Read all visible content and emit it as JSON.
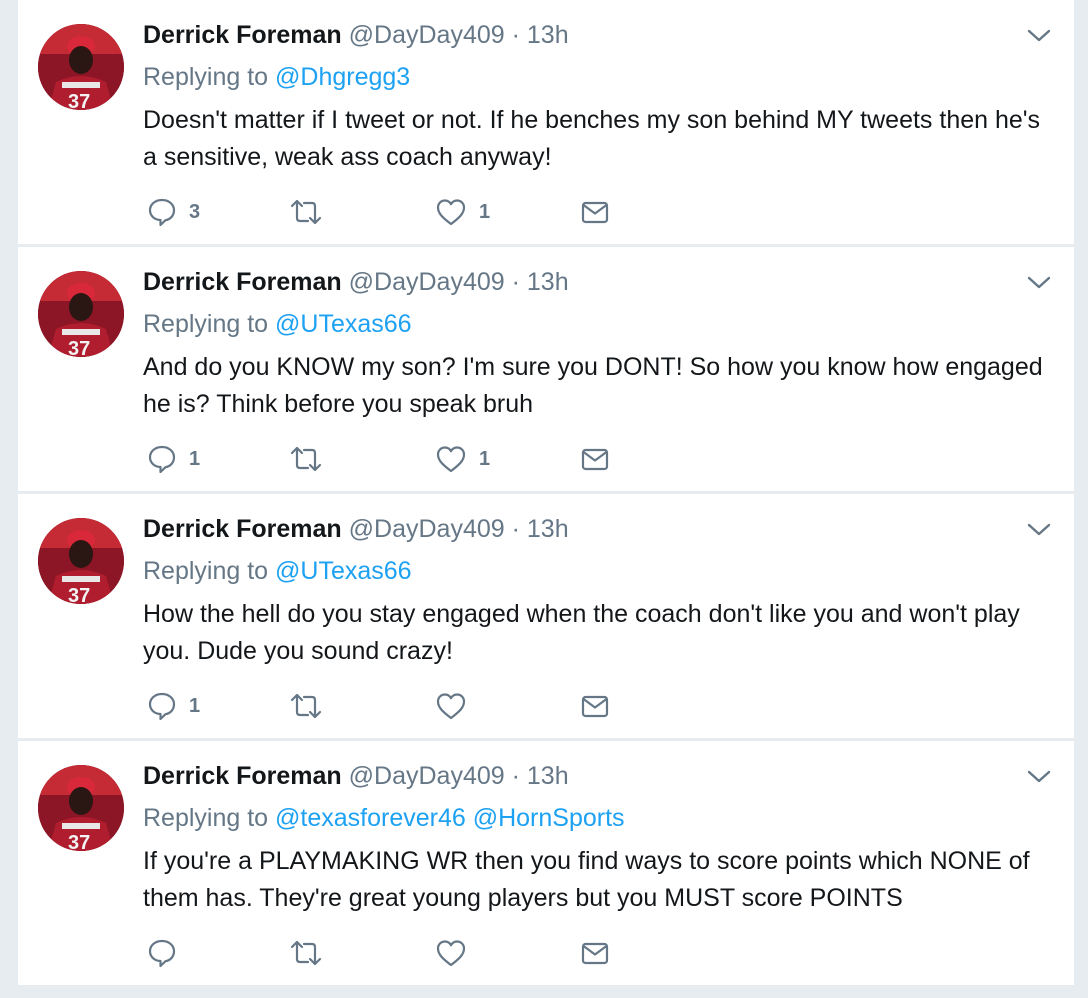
{
  "tweets": [
    {
      "name": "Derrick Foreman",
      "handle": "@DayDay409",
      "separator": "·",
      "time": "13h",
      "replying_label": "Replying to",
      "mentions": "@Dhgregg3",
      "text": "Doesn't matter if I tweet or not. If he benches my son behind MY tweets then he's a sensitive, weak ass coach anyway!",
      "reply_count": "3",
      "retweet_count": "",
      "like_count": "1"
    },
    {
      "name": "Derrick Foreman",
      "handle": "@DayDay409",
      "separator": "·",
      "time": "13h",
      "replying_label": "Replying to",
      "mentions": "@UTexas66",
      "text": "And do you KNOW my son? I'm sure you DONT! So how you know how engaged he is? Think before you speak bruh",
      "reply_count": "1",
      "retweet_count": "",
      "like_count": "1"
    },
    {
      "name": "Derrick Foreman",
      "handle": "@DayDay409",
      "separator": "·",
      "time": "13h",
      "replying_label": "Replying to",
      "mentions": "@UTexas66",
      "text": "How the hell do you stay engaged when the coach don't like you and won't play you. Dude you sound crazy!",
      "reply_count": "1",
      "retweet_count": "",
      "like_count": ""
    },
    {
      "name": "Derrick Foreman",
      "handle": "@DayDay409",
      "separator": "·",
      "time": "13h",
      "replying_label": "Replying to",
      "mentions": "@texasforever46 @HornSports",
      "text": "If you're a PLAYMAKING WR then you find ways to score points which NONE of them has. They're great young players but you MUST score POINTS",
      "reply_count": "",
      "retweet_count": "",
      "like_count": ""
    }
  ],
  "colors": {
    "name": "#14171a",
    "secondary": "#657786",
    "link": "#1da1f2",
    "background": "#e6ecf0",
    "card": "#ffffff"
  },
  "icons": {
    "reply": "reply-icon",
    "retweet": "retweet-icon",
    "like": "heart-icon",
    "message": "envelope-icon",
    "more": "chevron-down-icon"
  }
}
